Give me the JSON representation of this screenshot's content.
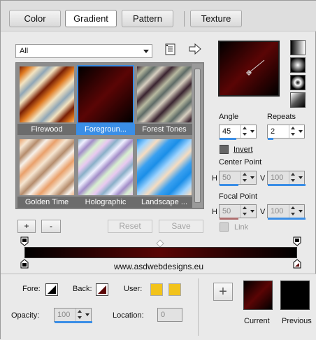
{
  "tabs": [
    "Color",
    "Gradient",
    "Pattern",
    "Texture"
  ],
  "active_tab": "Gradient",
  "category": {
    "selected": "All"
  },
  "gradients": [
    {
      "label": "Firewood",
      "selected": false
    },
    {
      "label": "Foregroun...",
      "selected": true
    },
    {
      "label": "Forest Tones",
      "selected": false
    },
    {
      "label": "Golden Time",
      "selected": false
    },
    {
      "label": "Holographic",
      "selected": false
    },
    {
      "label": "Landscape ...",
      "selected": false
    }
  ],
  "buttons": {
    "add": "+",
    "remove": "-",
    "reset": "Reset",
    "save": "Save",
    "new": "+"
  },
  "angle": {
    "label": "Angle",
    "value": "45"
  },
  "repeats": {
    "label": "Repeats",
    "value": "2"
  },
  "invert": {
    "label": "Invert",
    "checked": false
  },
  "center_point": {
    "label": "Center Point",
    "h_label": "H",
    "h_value": "50",
    "v_label": "V",
    "v_value": "100"
  },
  "focal_point": {
    "label": "Focal Point",
    "h_label": "H",
    "h_value": "50",
    "v_label": "V",
    "v_value": "100"
  },
  "link": {
    "label": "Link"
  },
  "watermark": "www.asdwebdesigns.eu",
  "fore_label": "Fore:",
  "back_label": "Back:",
  "user_label": "User:",
  "opacity": {
    "label": "Opacity:",
    "value": "100"
  },
  "location": {
    "label": "Location:",
    "value": "0"
  },
  "current_label": "Current",
  "previous_label": "Previous",
  "colors": {
    "accent": "#3a8ee6",
    "dark_red": "#5a0505",
    "user_yellow": "#f2c31b"
  }
}
